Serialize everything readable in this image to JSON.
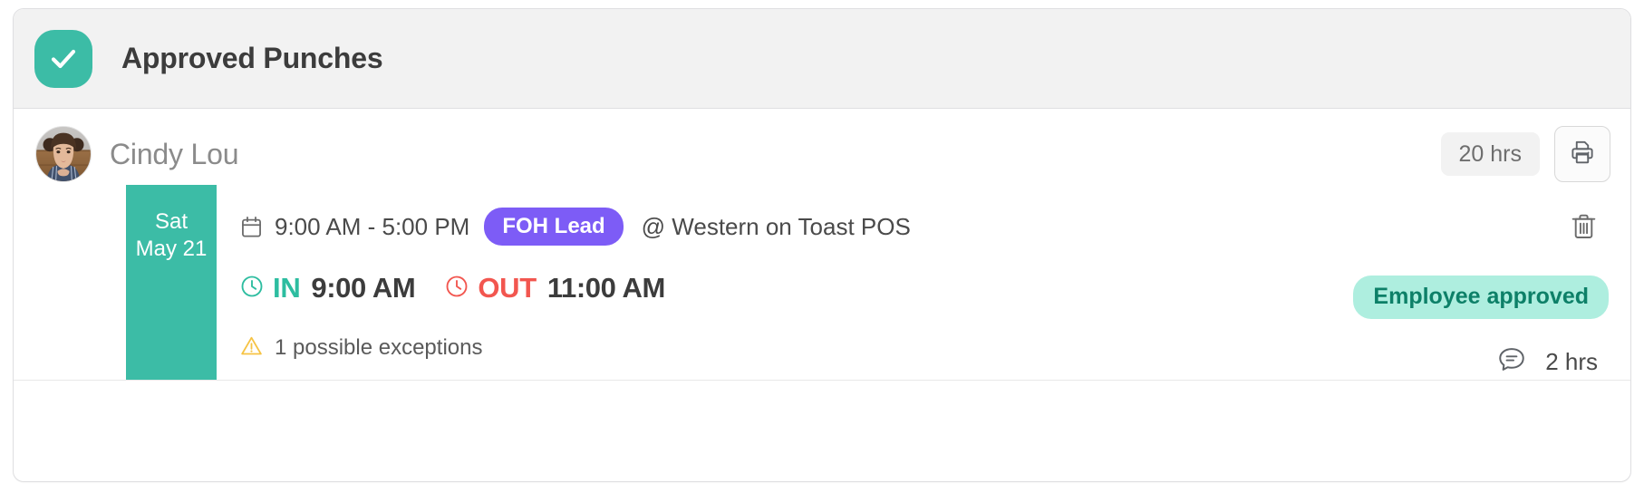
{
  "header": {
    "title": "Approved Punches",
    "check_icon": "check-circle-icon",
    "accent_color": "#3cbca6",
    "background_color": "#f2f2f2"
  },
  "employee": {
    "name": "Cindy Lou",
    "avatar_icon": "user-photo-avatar",
    "total_hours": "20 hrs",
    "print_icon": "printer-icon"
  },
  "punch": {
    "date": {
      "day_of_week": "Sat",
      "day_of_month": "May 21",
      "background_color": "#3cbca6"
    },
    "calendar_icon": "calendar-icon",
    "shift_time": "9:00 AM - 5:00 PM",
    "role": "FOH Lead",
    "role_color": "#7d5cf6",
    "location": "@ Western on Toast POS",
    "clock_in_icon": "clock-icon",
    "in_label": "IN",
    "in_time": "9:00 AM",
    "in_color": "#2dbda0",
    "clock_out_icon": "clock-icon",
    "out_label": "OUT",
    "out_time": "11:00 AM",
    "out_color": "#f2564f",
    "warning_icon": "warning-triangle-icon",
    "exceptions": "1 possible exceptions",
    "delete_icon": "trash-icon",
    "status": "Employee approved",
    "status_bg_color": "#aeeedf",
    "status_text_color": "#0d8068",
    "comment_icon": "comment-bubble-icon",
    "comment_hours": "2 hrs"
  }
}
